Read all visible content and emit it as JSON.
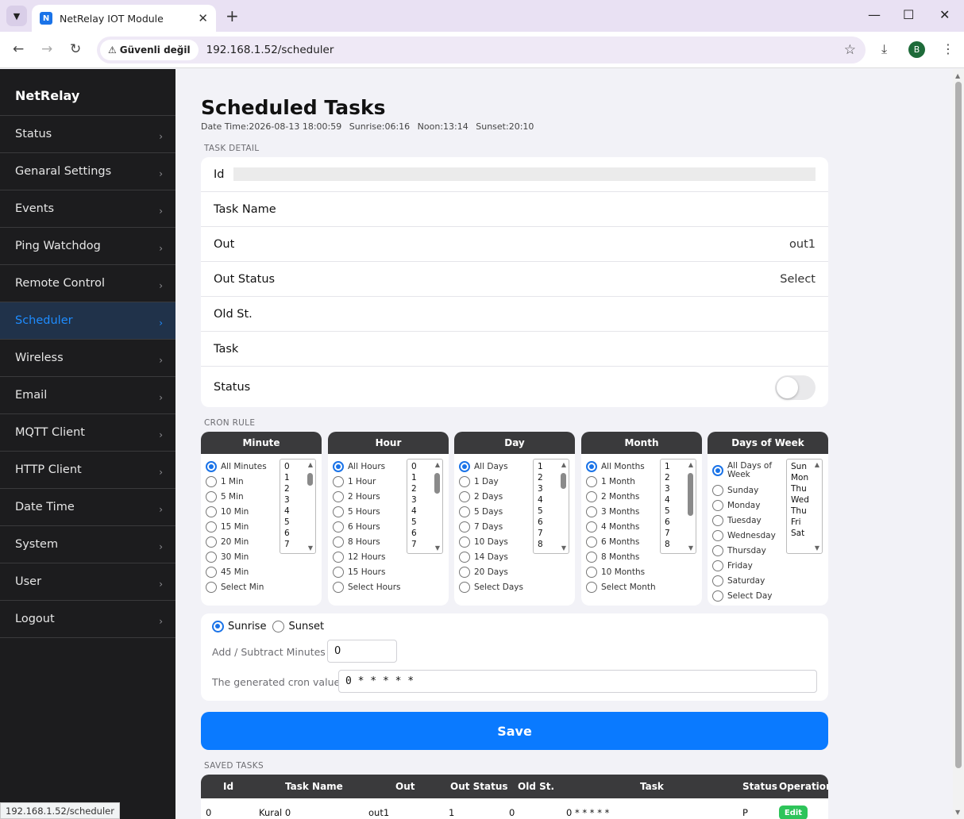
{
  "browser": {
    "tab_title": "NetRelay IOT Module",
    "tab_favicon": "N",
    "security_label": "Güvenli değil",
    "url": "192.168.1.52/scheduler",
    "avatar_letter": "B",
    "status_url": "192.168.1.52/scheduler"
  },
  "sidebar": {
    "brand": "NetRelay",
    "items": [
      {
        "label": "Status"
      },
      {
        "label": "Genaral Settings"
      },
      {
        "label": "Events"
      },
      {
        "label": "Ping Watchdog"
      },
      {
        "label": "Remote Control"
      },
      {
        "label": "Scheduler"
      },
      {
        "label": "Wireless"
      },
      {
        "label": "Email"
      },
      {
        "label": "MQTT Client"
      },
      {
        "label": "HTTP Client"
      },
      {
        "label": "Date Time"
      },
      {
        "label": "System"
      },
      {
        "label": "User"
      },
      {
        "label": "Logout"
      }
    ],
    "active_item": "Scheduler"
  },
  "page": {
    "title": "Scheduled Tasks",
    "date_time": "Date Time:2026-08-13 18:00:59",
    "sunrise": "Sunrise:06:16",
    "noon": "Noon:13:14",
    "sunset": "Sunset:20:10"
  },
  "task_detail": {
    "section_label": "TASK DETAIL",
    "id_label": "Id",
    "id_value": "",
    "task_name_label": "Task Name",
    "out_label": "Out",
    "out_value": "out1",
    "out_status_label": "Out Status",
    "out_status_value": "Select",
    "old_st_label": "Old St.",
    "task_label": "Task",
    "status_label": "Status",
    "status_on": false
  },
  "cron": {
    "section_label": "CRON RULE",
    "minute": {
      "title": "Minute",
      "options": [
        "All Minutes",
        "1 Min",
        "5 Min",
        "10 Min",
        "15 Min",
        "20 Min",
        "30 Min",
        "45 Min",
        "Select Min"
      ],
      "list": [
        "0",
        "1",
        "2",
        "3",
        "4",
        "5",
        "6",
        "7"
      ]
    },
    "hour": {
      "title": "Hour",
      "options": [
        "All Hours",
        "1 Hour",
        "2 Hours",
        "5 Hours",
        "6 Hours",
        "8 Hours",
        "12 Hours",
        "15 Hours",
        "Select Hours"
      ],
      "list": [
        "0",
        "1",
        "2",
        "3",
        "4",
        "5",
        "6",
        "7"
      ]
    },
    "day": {
      "title": "Day",
      "options": [
        "All Days",
        "1 Day",
        "2 Days",
        "5 Days",
        "7 Days",
        "10 Days",
        "14 Days",
        "20 Days",
        "Select Days"
      ],
      "list": [
        "1",
        "2",
        "3",
        "4",
        "5",
        "6",
        "7",
        "8"
      ]
    },
    "month": {
      "title": "Month",
      "options": [
        "All Months",
        "1 Month",
        "2 Months",
        "3 Months",
        "4 Months",
        "6 Months",
        "8 Months",
        "10 Months",
        "Select Month"
      ],
      "list": [
        "1",
        "2",
        "3",
        "4",
        "5",
        "6",
        "7",
        "8"
      ]
    },
    "dow": {
      "title": "Days of Week",
      "options": [
        "All Days of Week",
        "Sunday",
        "Monday",
        "Tuesday",
        "Wednesday",
        "Thursday",
        "Friday",
        "Saturday",
        "Select Day"
      ],
      "list": [
        "Sun",
        "Mon",
        "Thu",
        "Wed",
        "Thu",
        "Fri",
        "Sat"
      ]
    }
  },
  "sun": {
    "sunrise_label": "Sunrise",
    "sunset_label": "Sunset",
    "selected": "Sunrise",
    "add_subtract_label": "Add / Subtract Minutes",
    "add_subtract_value": "0",
    "cron_value_label": "The generated cron value",
    "cron_value": "0 * * * * *"
  },
  "save_label": "Save",
  "saved_tasks": {
    "section_label": "SAVED TASKS",
    "headers": [
      "Id",
      "Task Name",
      "Out",
      "Out Status",
      "Old St.",
      "Task",
      "Status",
      "Operation"
    ],
    "rows": [
      {
        "id": "0",
        "task_name": "Kural 0",
        "out": "out1",
        "out_status": "1",
        "old_st": "0",
        "task": "0 * * * * *",
        "status": "P",
        "operation": "Edit"
      }
    ]
  },
  "colors": {
    "accent": "#0a7aff",
    "sidebar_bg": "#1c1c1e",
    "active_nav": "#1e8cff",
    "edit_button": "#2ec45a"
  }
}
